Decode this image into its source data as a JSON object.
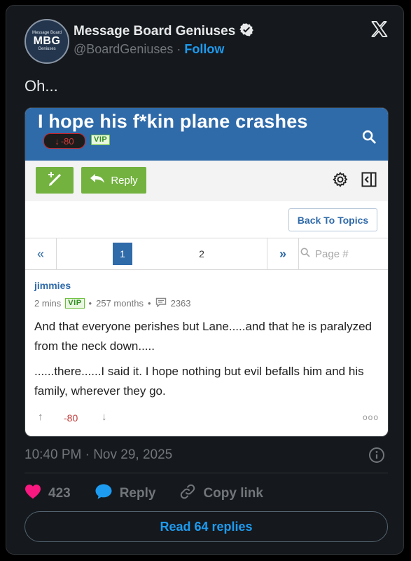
{
  "tweet": {
    "avatar": {
      "line1": "Message Board",
      "line2": "MBG",
      "line3": "Geniuses"
    },
    "display_name": "Message Board Geniuses",
    "handle": "@BoardGeniuses",
    "separator": "·",
    "follow_label": "Follow",
    "text": "Oh...",
    "timestamp": "10:40 PM · Nov 29, 2025",
    "likes": "423",
    "reply_label": "Reply",
    "copy_link_label": "Copy link",
    "read_replies_label": "Read 64 replies",
    "colors": {
      "background": "#15181c",
      "accent": "#1d9bf0",
      "like": "#f91880",
      "muted": "#71767b"
    }
  },
  "embed": {
    "thread_title": "I hope his f*kin plane crashes",
    "thread_score": "-80",
    "vip_label": "VIP",
    "reply_button": "Reply",
    "back_to_topics": "Back To Topics",
    "pager": {
      "prev": "«",
      "pages": [
        "1",
        "2"
      ],
      "current": "1",
      "next": "»",
      "page_placeholder": "Page #"
    },
    "post": {
      "username": "jimmies",
      "time": "2 mins",
      "vip": "VIP",
      "tenure": "257 months",
      "post_count": "2363",
      "dot": "•",
      "paragraphs": [
        "And that everyone perishes but Lane.....and that he is paralyzed from the neck down.....",
        "......there......I said it. I hope nothing but evil befalls him and his family, wherever they go."
      ],
      "score": "-80",
      "more": "ooo"
    },
    "colors": {
      "header": "#2f6aa9",
      "green": "#73b23f",
      "negative": "#c23b3b"
    }
  }
}
